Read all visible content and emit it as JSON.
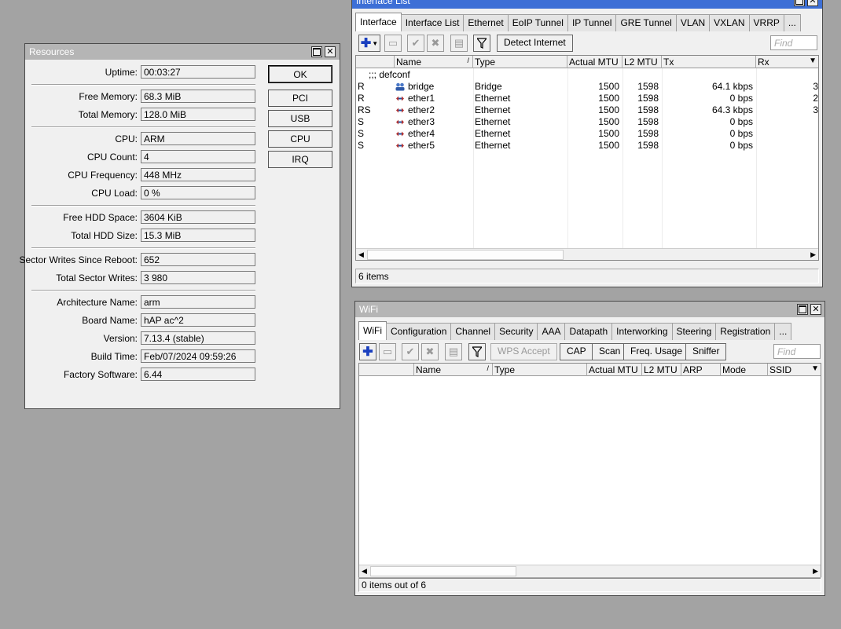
{
  "resources": {
    "title": "Resources",
    "fields": [
      {
        "label": "Uptime:",
        "value": "00:03:27"
      },
      {
        "label": "Free Memory:",
        "value": "68.3 MiB"
      },
      {
        "label": "Total Memory:",
        "value": "128.0 MiB"
      },
      {
        "label": "CPU:",
        "value": "ARM"
      },
      {
        "label": "CPU Count:",
        "value": "4"
      },
      {
        "label": "CPU Frequency:",
        "value": "448 MHz"
      },
      {
        "label": "CPU Load:",
        "value": "0 %"
      },
      {
        "label": "Free HDD Space:",
        "value": "3604 KiB"
      },
      {
        "label": "Total HDD Size:",
        "value": "15.3 MiB"
      },
      {
        "label": "Sector Writes Since Reboot:",
        "value": "652"
      },
      {
        "label": "Total Sector Writes:",
        "value": "3 980"
      },
      {
        "label": "Architecture Name:",
        "value": "arm"
      },
      {
        "label": "Board Name:",
        "value": "hAP ac^2"
      },
      {
        "label": "Version:",
        "value": "7.13.4 (stable)"
      },
      {
        "label": "Build Time:",
        "value": "Feb/07/2024 09:59:26"
      },
      {
        "label": "Factory Software:",
        "value": "6.44"
      }
    ],
    "buttons": {
      "ok": "OK",
      "pci": "PCI",
      "usb": "USB",
      "cpu": "CPU",
      "irq": "IRQ"
    }
  },
  "interface_list": {
    "title": "Interface List",
    "tabs": [
      "Interface",
      "Interface List",
      "Ethernet",
      "EoIP Tunnel",
      "IP Tunnel",
      "GRE Tunnel",
      "VLAN",
      "VXLAN",
      "VRRP",
      "..."
    ],
    "detect_internet": "Detect Internet",
    "find_placeholder": "Find",
    "columns": [
      "Name",
      "Type",
      "Actual MTU",
      "L2 MTU",
      "Tx",
      "Rx"
    ],
    "comment": ";;; defconf",
    "rows": [
      {
        "flags": "R",
        "name": "bridge",
        "type": "Bridge",
        "mtu": "1500",
        "l2mtu": "1598",
        "tx": "64.1 kbps",
        "rx": "3",
        "icon": "bridge-icon"
      },
      {
        "flags": "R",
        "name": "ether1",
        "type": "Ethernet",
        "mtu": "1500",
        "l2mtu": "1598",
        "tx": "0 bps",
        "rx": "2",
        "icon": "ethernet-icon"
      },
      {
        "flags": "RS",
        "name": "ether2",
        "type": "Ethernet",
        "mtu": "1500",
        "l2mtu": "1598",
        "tx": "64.3 kbps",
        "rx": "3",
        "icon": "ethernet-icon"
      },
      {
        "flags": "S",
        "name": "ether3",
        "type": "Ethernet",
        "mtu": "1500",
        "l2mtu": "1598",
        "tx": "0 bps",
        "rx": "",
        "icon": "ethernet-icon"
      },
      {
        "flags": "S",
        "name": "ether4",
        "type": "Ethernet",
        "mtu": "1500",
        "l2mtu": "1598",
        "tx": "0 bps",
        "rx": "",
        "icon": "ethernet-icon"
      },
      {
        "flags": "S",
        "name": "ether5",
        "type": "Ethernet",
        "mtu": "1500",
        "l2mtu": "1598",
        "tx": "0 bps",
        "rx": "",
        "icon": "ethernet-icon"
      }
    ],
    "status": "6 items"
  },
  "wifi": {
    "title": "WiFi",
    "tabs": [
      "WiFi",
      "Configuration",
      "Channel",
      "Security",
      "AAA",
      "Datapath",
      "Interworking",
      "Steering",
      "Registration",
      "..."
    ],
    "buttons": {
      "wps_accept": "WPS Accept",
      "cap": "CAP",
      "scan": "Scan",
      "freq_usage": "Freq. Usage",
      "sniffer": "Sniffer"
    },
    "find_placeholder": "Find",
    "columns": [
      "Name",
      "Type",
      "Actual MTU",
      "L2 MTU",
      "ARP",
      "Mode",
      "SSID"
    ],
    "status": "0 items out of 6"
  },
  "colors": {
    "desktop": "#a3a3a3",
    "active_title": "#3d6fd6",
    "inactive_title": "#b5b5b5",
    "add_icon": "#1a3fbf"
  }
}
